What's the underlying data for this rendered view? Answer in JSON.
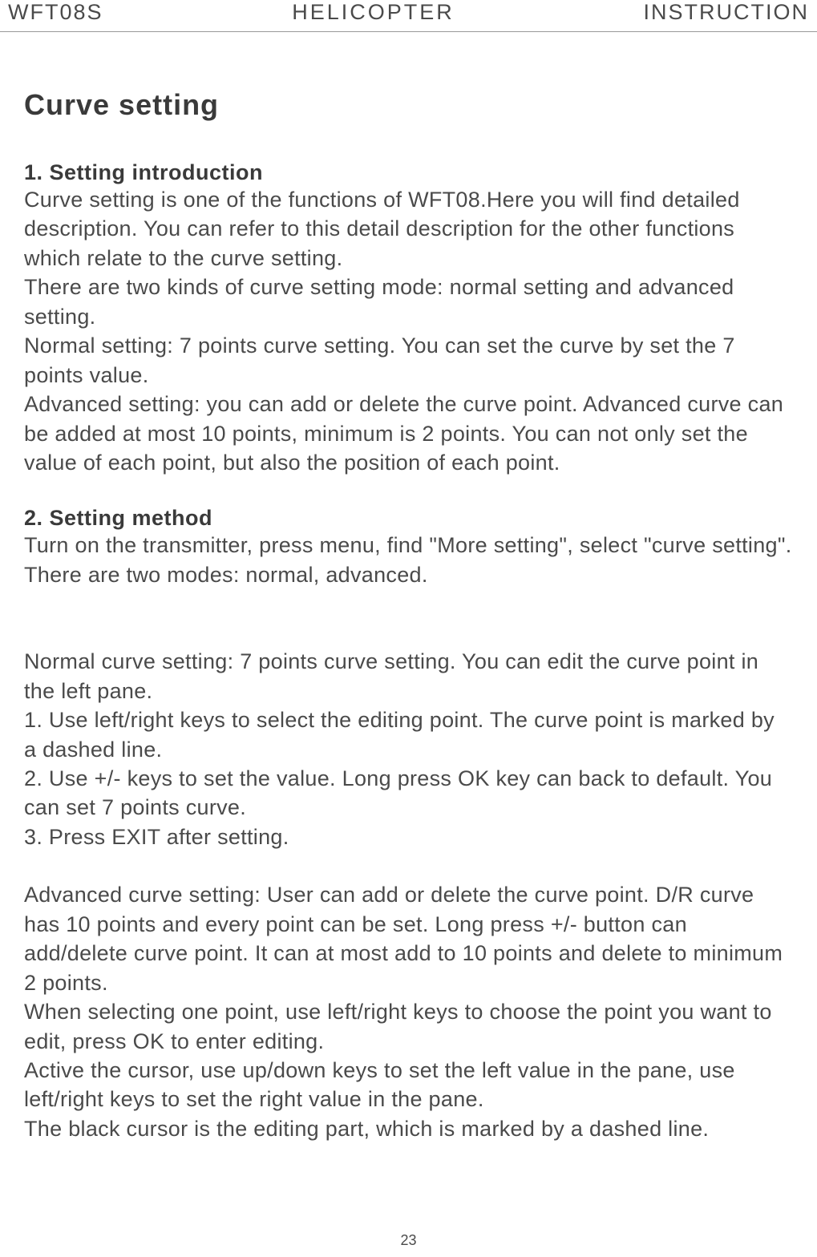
{
  "header": {
    "left": "WFT08S",
    "center": "HELICOPTER",
    "right": "INSTRUCTION"
  },
  "title": "Curve setting",
  "section1": {
    "heading": "1. Setting introduction",
    "p1": "Curve setting is one of the functions of WFT08.Here you will find detailed description. You can refer to this detail description for the other functions which relate to the curve setting.",
    "p2": "There are two kinds of curve setting mode: normal setting and advanced setting.",
    "p3": "Normal setting: 7 points curve setting. You can set the curve by set the 7 points value.",
    "p4": "Advanced setting: you can add or delete the curve point. Advanced curve can be added at most 10 points, minimum is 2 points. You can not only set the value of each point, but also the position of each point."
  },
  "section2": {
    "heading": "2. Setting method",
    "p1": "Turn on the transmitter, press menu, find \"More setting\", select \"curve setting\".",
    "p2": "There are two modes: normal, advanced."
  },
  "normal": {
    "p1": "Normal curve setting: 7 points curve setting. You can edit the curve point in the left pane.",
    "p2": "1. Use left/right keys to select the editing point. The curve point is marked by a dashed line.",
    "p3": "2. Use +/-  keys to set the value. Long press OK key can back to default. You can set 7 points curve.",
    "p4": "3. Press EXIT after setting."
  },
  "advanced": {
    "p1": "Advanced curve setting: User can add or delete the curve point. D/R curve has 10 points and every point can be set. Long press +/- button can add/delete curve point. It can at most add to 10 points and delete to minimum 2 points.",
    "p2": "When selecting one point, use left/right keys to choose the point you want to edit, press OK to enter editing.",
    "p3": "Active the cursor, use up/down keys to set the left value in the pane, use left/right keys to set the right value in the pane.",
    "p4": "The black cursor is the editing part, which is marked by a dashed line."
  },
  "pageNumber": "23"
}
